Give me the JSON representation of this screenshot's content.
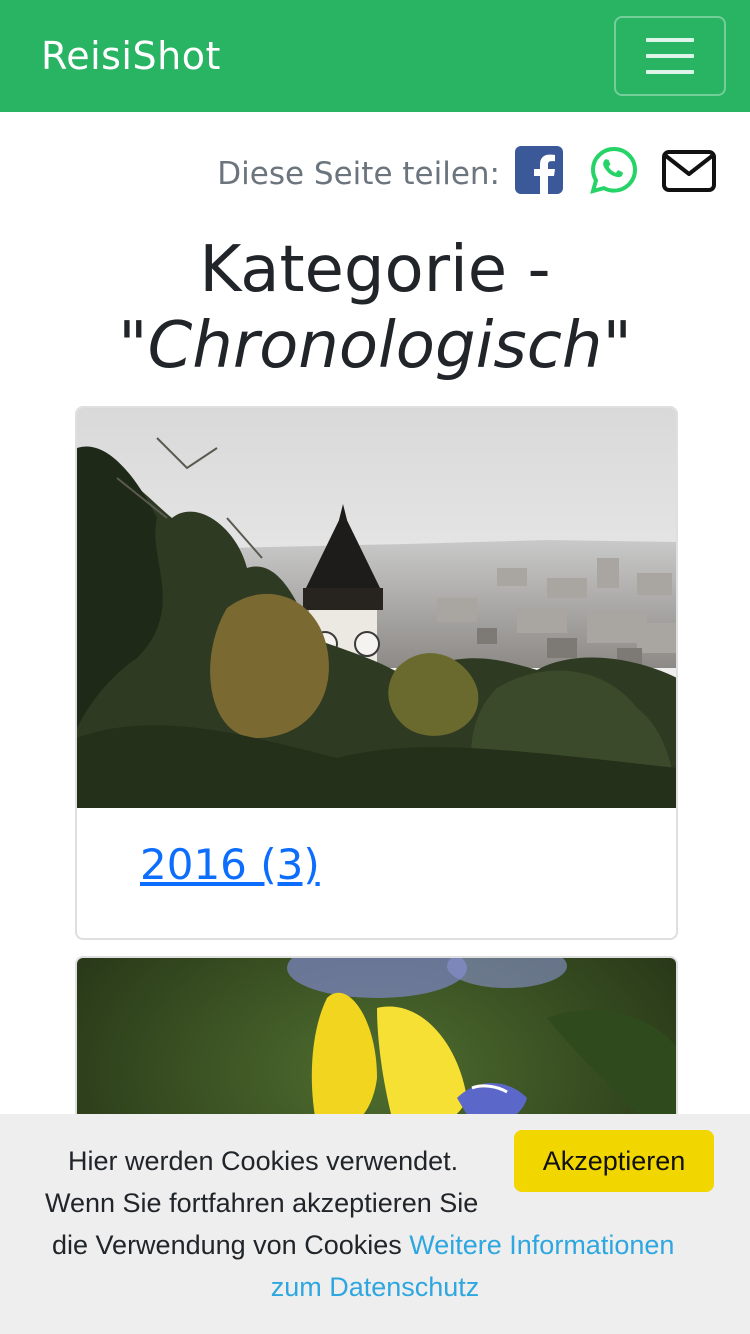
{
  "navbar": {
    "brand": "ReisiShot",
    "toggler_icon": "hamburger-menu-icon",
    "color": "#28b463"
  },
  "share": {
    "label": "Diese Seite teilen:",
    "icons": [
      "facebook-icon",
      "whatsapp-icon",
      "mail-icon"
    ],
    "facebook_color": "#3b5998",
    "whatsapp_color": "#25d366"
  },
  "heading": {
    "prefix": "Kategorie -",
    "category": "\"Chronologisch\""
  },
  "cards": [
    {
      "link": "2016 (3)",
      "image": "Graz clock tower over city view"
    },
    {
      "link": "",
      "image": "yellow iris flower"
    }
  ],
  "cookie": {
    "line1": "Hier werden Cookies verwendet.",
    "line2": "Wenn Sie fortfahren akzeptieren Sie",
    "line3": "die Verwendung von Cookies ",
    "link_part1": "Weitere Informationen",
    "link_part2": "zum Datenschutz",
    "accept": "Akzeptieren",
    "accept_color": "#f1d600",
    "link_color": "#2ea7e0"
  }
}
